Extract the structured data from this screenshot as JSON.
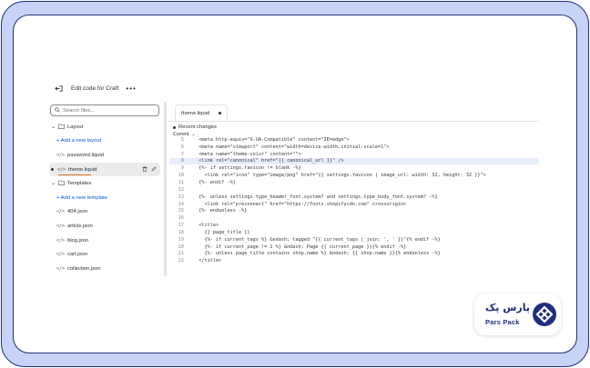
{
  "topbar": {
    "title": "Edit code for Craft",
    "more": "•••"
  },
  "search": {
    "placeholder": "Search files..."
  },
  "sidebar": {
    "layout_folder": "Layout",
    "layout_add": "+ Add a new layout",
    "password_file": "password.liquid",
    "theme_file": "theme.liquid",
    "templates_folder": "Templates",
    "templates_add": "+ Add a new template",
    "files": [
      "404.json",
      "article.json",
      "blog.json",
      "cart.json",
      "collection.json"
    ]
  },
  "tab": {
    "label": "theme.liquid"
  },
  "changes": {
    "title": "Recent changes",
    "current": "Current"
  },
  "code": {
    "lines": [
      {
        "n": "5",
        "t": "  <meta http-equiv=\"X-UA-Compatible\" content=\"IE=edge\">"
      },
      {
        "n": "6",
        "t": "  <meta name=\"viewport\" content=\"width=device-width,initial-scale=1\">"
      },
      {
        "n": "7",
        "t": "  <meta name=\"theme-color\" content=\"\">"
      },
      {
        "n": "8",
        "t": "  <link rel=\"canonical\" href=\"{{ canonical_url }}\" />"
      },
      {
        "n": "9",
        "t": "  {%- if settings.favicon != blank -%}"
      },
      {
        "n": "10",
        "t": "    <link rel=\"icon\" type=\"image/png\" href=\"{{ settings.favicon | image_url: width: 32, height: 32 }}\">"
      },
      {
        "n": "11",
        "t": "  {%- endif -%}"
      },
      {
        "n": "12",
        "t": ""
      },
      {
        "n": "13",
        "t": "  {%- unless settings.type_header_font.system? and settings.type_body_font.system? -%}"
      },
      {
        "n": "14",
        "t": "    <link rel=\"preconnect\" href=\"https://fonts.shopifycdn.com\" crossorigin>"
      },
      {
        "n": "15",
        "t": "  {%- endunless -%}"
      },
      {
        "n": "16",
        "t": ""
      },
      {
        "n": "17",
        "t": "  <title>"
      },
      {
        "n": "18",
        "t": "    {{ page_title }}"
      },
      {
        "n": "19",
        "t": "    {%- if current_tags %} &ndash; tagged \"{{ current_tags | join: ', ' }}\"{% endif -%}"
      },
      {
        "n": "20",
        "t": "    {%- if current_page != 1 %} &ndash; Page {{ current_page }}{% endif -%}"
      },
      {
        "n": "21",
        "t": "    {%- unless page_title contains shop.name %} &ndash; {{ shop.name }}{% endunless -%}"
      },
      {
        "n": "22",
        "t": "  </title>"
      }
    ]
  },
  "logo": {
    "fa": "پارس پک",
    "en": "Pars Pack"
  },
  "colors": {
    "accent": "#1f2f7a",
    "frame_bg": "#c7d3f7",
    "highlight": "#e6ecfa",
    "underline": "#e1721d"
  }
}
